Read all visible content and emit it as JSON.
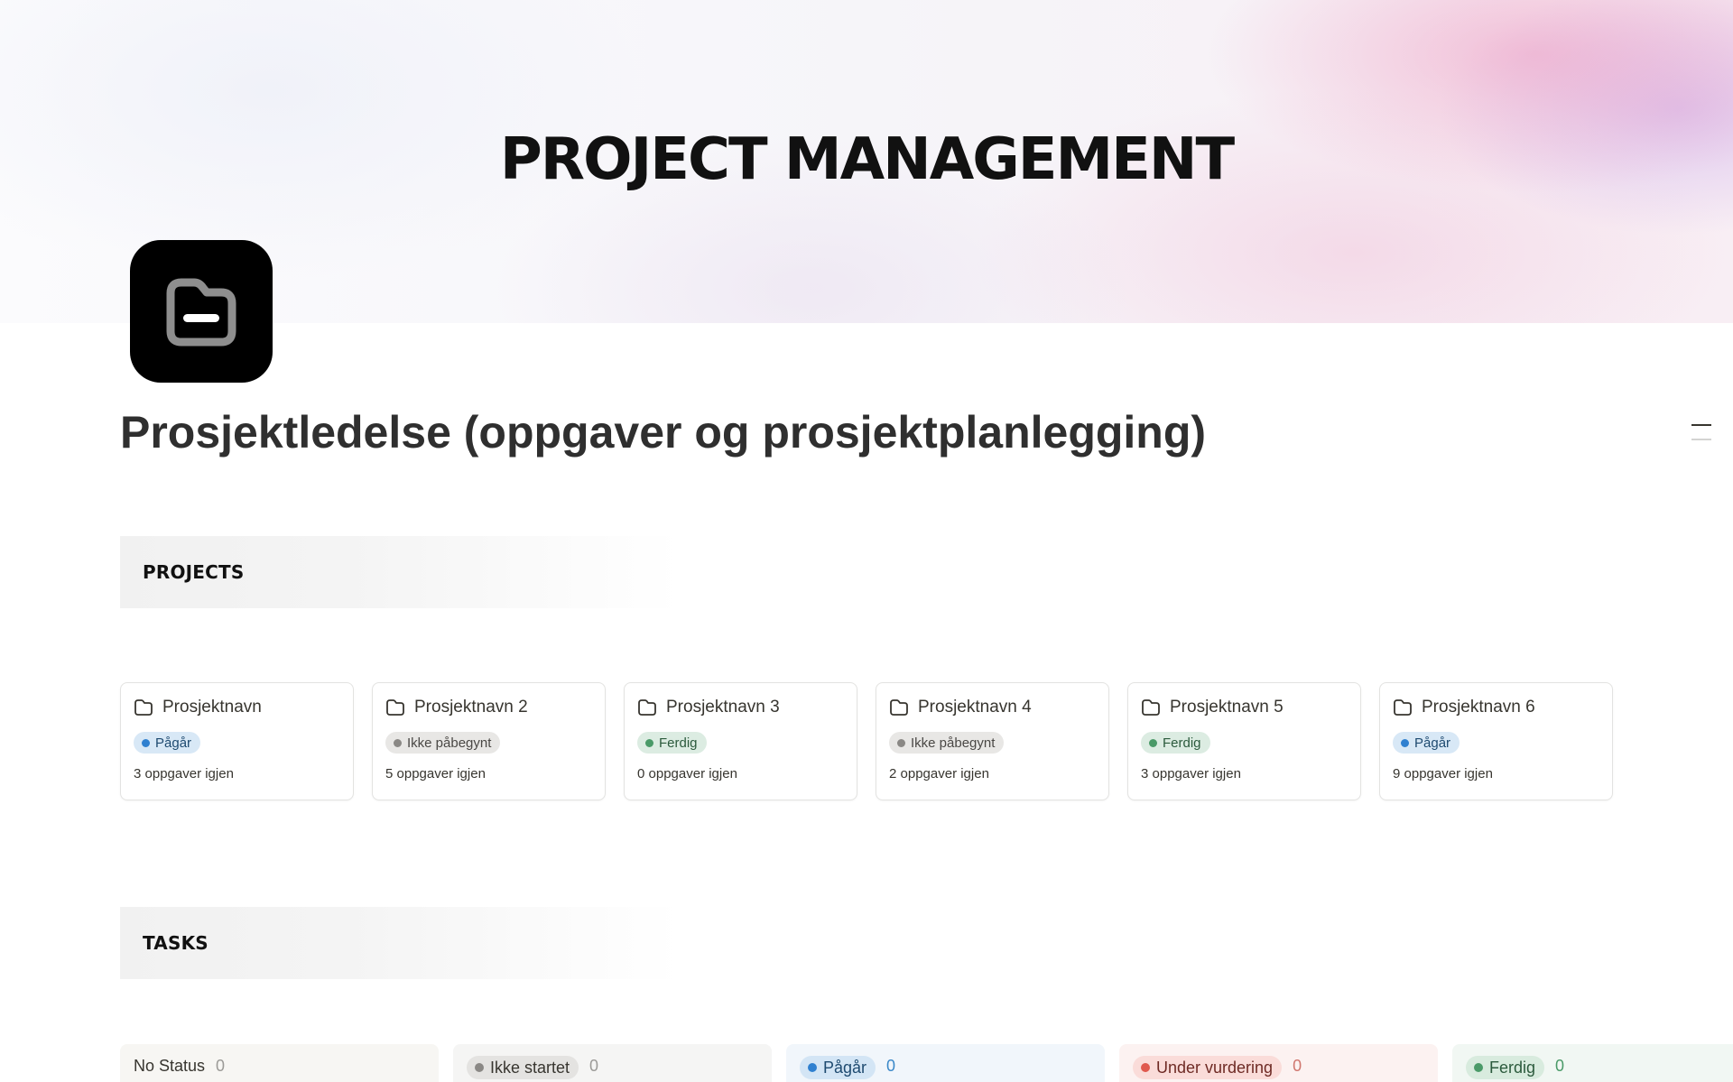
{
  "cover": {
    "title": "PROJECT MANAGEMENT"
  },
  "page": {
    "icon": "folder-icon",
    "title": "Prosjektledelse (oppgaver og prosjektplanlegging)"
  },
  "sections": {
    "projects": "PROJECTS",
    "tasks": "TASKS"
  },
  "projects": [
    {
      "name": "Prosjektnavn",
      "status": "Pågår",
      "status_color": "blue",
      "remaining": "3 oppgaver igjen"
    },
    {
      "name": "Prosjektnavn 2",
      "status": "Ikke påbegynt",
      "status_color": "gray",
      "remaining": "5 oppgaver igjen"
    },
    {
      "name": "Prosjektnavn 3",
      "status": "Ferdig",
      "status_color": "green",
      "remaining": "0 oppgaver igjen"
    },
    {
      "name": "Prosjektnavn 4",
      "status": "Ikke påbegynt",
      "status_color": "gray",
      "remaining": "2 oppgaver igjen"
    },
    {
      "name": "Prosjektnavn 5",
      "status": "Ferdig",
      "status_color": "green",
      "remaining": "3 oppgaver igjen"
    },
    {
      "name": "Prosjektnavn 6",
      "status": "Pågår",
      "status_color": "blue",
      "remaining": "9 oppgaver igjen"
    }
  ],
  "task_columns": [
    {
      "label": "No Status",
      "count": "0",
      "color": "none"
    },
    {
      "label": "Ikke startet",
      "count": "0",
      "color": "gray"
    },
    {
      "label": "Pågår",
      "count": "0",
      "color": "blue"
    },
    {
      "label": "Under vurdering",
      "count": "0",
      "color": "red"
    },
    {
      "label": "Ferdig",
      "count": "0",
      "color": "green"
    }
  ],
  "colors": {
    "blue": "#2f80d0",
    "gray": "#8a8885",
    "green": "#4a9a68",
    "red": "#e0594e"
  }
}
